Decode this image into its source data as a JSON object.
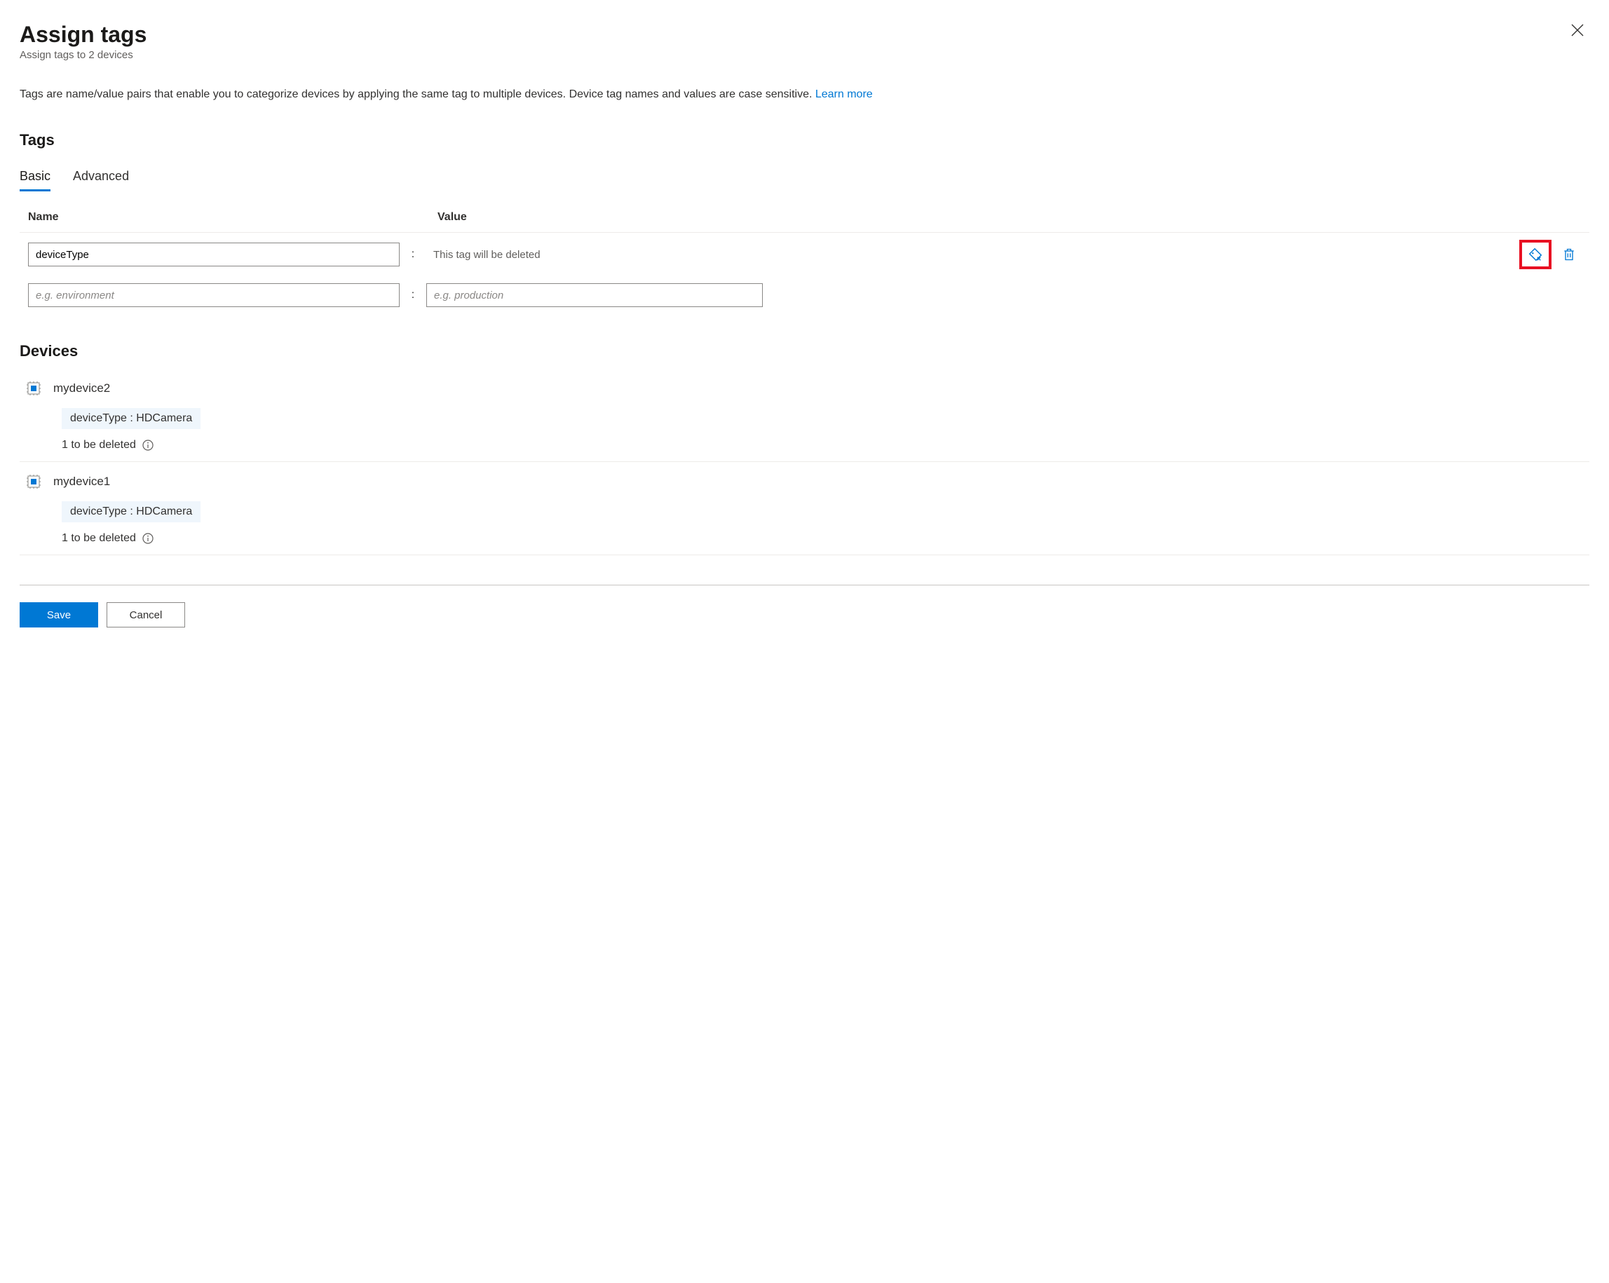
{
  "header": {
    "title": "Assign tags",
    "subtitle": "Assign tags to 2 devices"
  },
  "description": {
    "text": "Tags are name/value pairs that enable you to categorize devices by applying the same tag to multiple devices. Device tag names and values are case sensitive. ",
    "link": "Learn more"
  },
  "sections": {
    "tags_heading": "Tags",
    "devices_heading": "Devices"
  },
  "tabs": {
    "basic": "Basic",
    "advanced": "Advanced"
  },
  "columns": {
    "name": "Name",
    "value": "Value"
  },
  "tag_rows": [
    {
      "name_value": "deviceType",
      "value_display": "This tag will be deleted",
      "deleted": true
    },
    {
      "name_placeholder": "e.g. environment",
      "value_placeholder": "e.g. production",
      "deleted": false
    }
  ],
  "devices": [
    {
      "name": "mydevice2",
      "chip": "deviceType : HDCamera",
      "note": "1 to be deleted"
    },
    {
      "name": "mydevice1",
      "chip": "deviceType : HDCamera",
      "note": "1 to be deleted"
    }
  ],
  "footer": {
    "save": "Save",
    "cancel": "Cancel"
  }
}
